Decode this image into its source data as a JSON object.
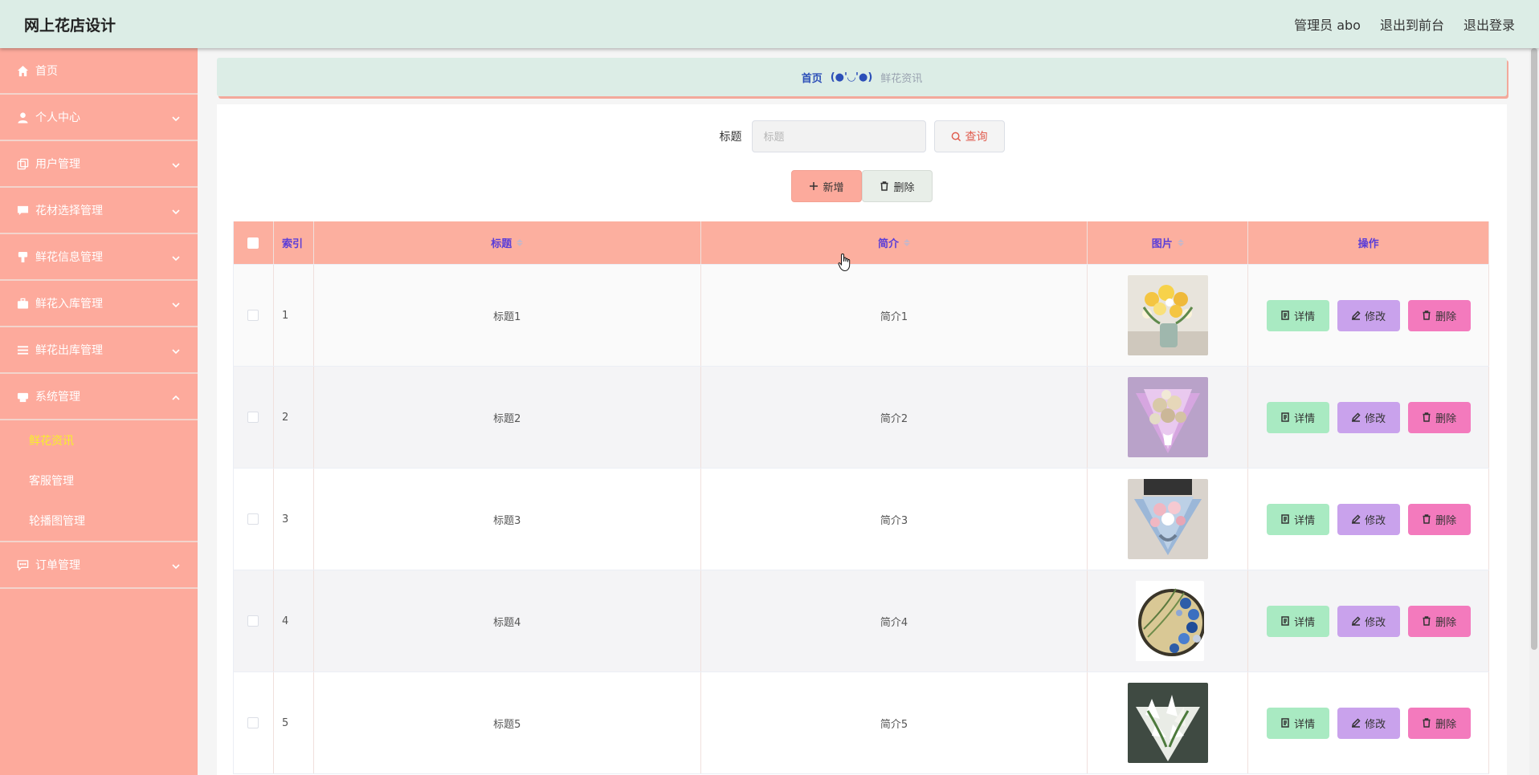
{
  "app": {
    "title": "网上花店设计",
    "user_label": "管理员 abo",
    "to_front_label": "退出到前台",
    "logout_label": "退出登录"
  },
  "sidebar": {
    "items": [
      {
        "label": "首页",
        "icon": "home-icon"
      },
      {
        "label": "个人中心",
        "icon": "user-icon"
      },
      {
        "label": "用户管理",
        "icon": "copy-icon"
      },
      {
        "label": "花材选择管理",
        "icon": "chat-icon"
      },
      {
        "label": "鲜花信息管理",
        "icon": "stamp-icon"
      },
      {
        "label": "鲜花入库管理",
        "icon": "briefcase-icon"
      },
      {
        "label": "鲜花出库管理",
        "icon": "menu-icon"
      },
      {
        "label": "系统管理",
        "icon": "printer-icon"
      },
      {
        "label": "订单管理",
        "icon": "message-icon"
      }
    ],
    "system_sub": [
      {
        "label": "鲜花资讯"
      },
      {
        "label": "客服管理"
      },
      {
        "label": "轮播图管理"
      }
    ]
  },
  "breadcrumb": {
    "home": "首页",
    "face": "(●'◡'●)",
    "current": "鲜花资讯"
  },
  "search": {
    "label": "标题",
    "placeholder": "标题",
    "query_label": "查询"
  },
  "actions": {
    "add_label": "新增",
    "delete_label": "删除"
  },
  "table": {
    "headers": {
      "index": "索引",
      "title": "标题",
      "intro": "简介",
      "image": "图片",
      "ops": "操作"
    },
    "rows": [
      {
        "index": "1",
        "title": "标题1",
        "intro": "简介1",
        "image": "yellow-bouquet-image"
      },
      {
        "index": "2",
        "title": "标题2",
        "intro": "简介2",
        "image": "purple-bouquet-image"
      },
      {
        "index": "3",
        "title": "标题3",
        "intro": "简介3",
        "image": "blue-bouquet-image"
      },
      {
        "index": "4",
        "title": "标题4",
        "intro": "简介4",
        "image": "blue-wreath-image"
      },
      {
        "index": "5",
        "title": "标题5",
        "intro": "简介5",
        "image": "white-lily-image"
      }
    ],
    "op_labels": {
      "detail": "详情",
      "edit": "修改",
      "delete": "删除"
    }
  },
  "colors": {
    "topbar": "#dcede6",
    "sidebar": "#fdaa9c",
    "table_header": "#fcaf9f",
    "detail_btn": "#a9eac2",
    "edit_btn": "#c9a2ec",
    "delete_btn": "#f37abd",
    "active_submenu": "#f7ef2a"
  }
}
